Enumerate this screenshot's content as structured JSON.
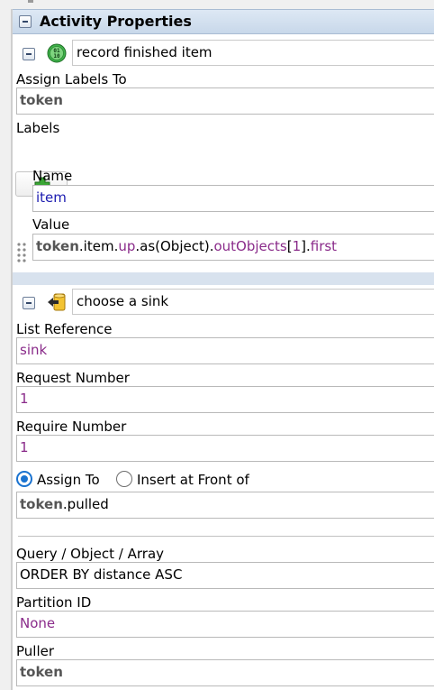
{
  "panel": {
    "title": "Activity Properties"
  },
  "activity1": {
    "name": "record finished item",
    "assign_labels_label": "Assign Labels To",
    "assign_labels_value": "token",
    "labels_label": "Labels",
    "name_label": "Name",
    "name_value": "item",
    "value_label": "Value",
    "value_expr": {
      "p1": "token",
      "p2": ".item.",
      "p3": "up",
      "p4": ".as(Object).",
      "p5": "outObjects",
      "p6": "[",
      "p7": "1",
      "p8": "].",
      "p9": "first"
    }
  },
  "activity2": {
    "name": "choose a sink",
    "list_reference_label": "List Reference",
    "list_reference_value": "sink",
    "request_number_label": "Request Number",
    "request_number_value": "1",
    "require_number_label": "Require Number",
    "require_number_value": "1",
    "assign_to_label": "Assign To",
    "insert_front_label": "Insert at Front of",
    "assign_to_selected": true,
    "assign_value_kw": "token",
    "assign_value_rest": ".pulled",
    "query_label": "Query / Object / Array",
    "query_value": "ORDER BY distance ASC",
    "partition_label": "Partition ID",
    "partition_value": "None",
    "puller_label": "Puller",
    "puller_value": "token"
  },
  "icons": {
    "collapse": "minus-box-icon",
    "label_activity": "binary-badge-icon",
    "pull_activity": "pull-list-icon",
    "add": "plus-icon",
    "drag": "drag-grip-icon"
  },
  "colors": {
    "header_bg": "#c8d8ea",
    "keyword": "#555555",
    "property": "#1c1cb0",
    "literal": "#8a2b8a",
    "radio_on": "#1a73d0"
  }
}
